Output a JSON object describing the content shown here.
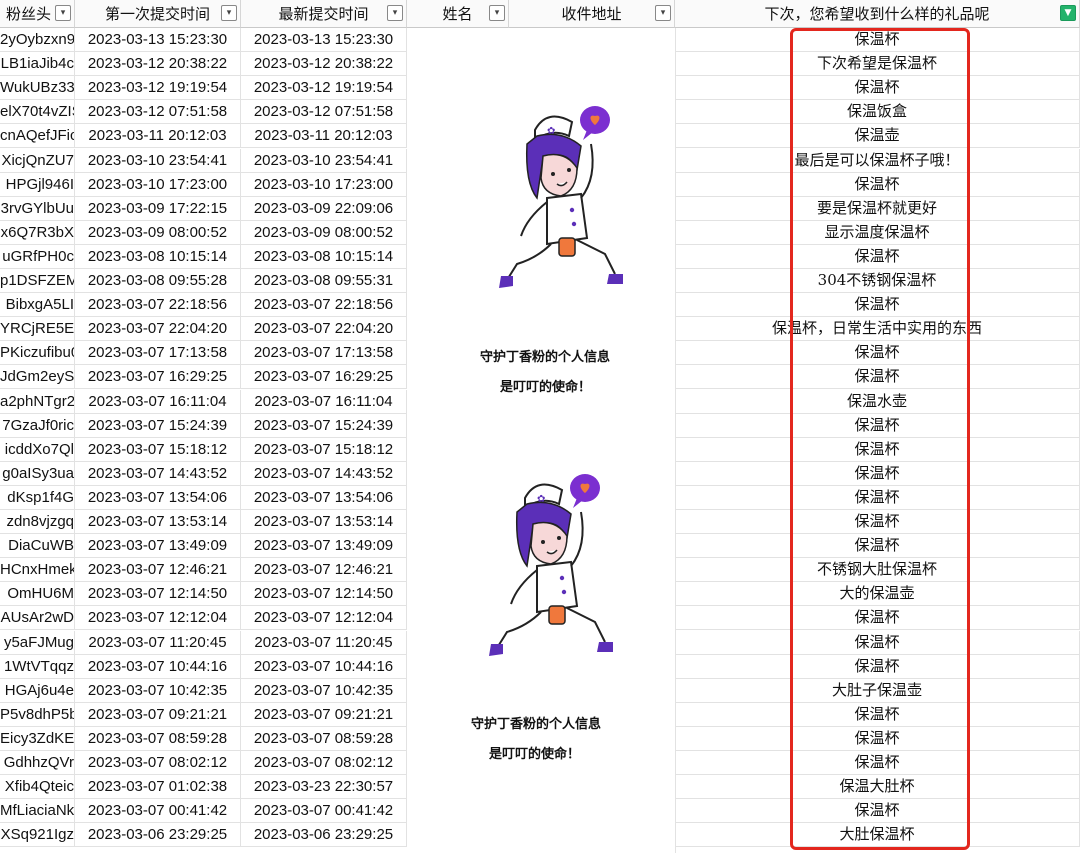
{
  "header": {
    "col_fan": "粉丝头",
    "col_first": "第一次提交时间",
    "col_latest": "最新提交时间",
    "col_name": "姓名",
    "col_address": "收件地址",
    "col_gift": "下次，您希望收到什么样的礼品呢"
  },
  "rows": [
    {
      "fan": "2yOybzxn9",
      "first": "2023-03-13 15:23:30",
      "latest": "2023-03-13 15:23:30",
      "gift": "保温杯"
    },
    {
      "fan": "LB1iaJib4c",
      "first": "2023-03-12 20:38:22",
      "latest": "2023-03-12 20:38:22",
      "gift": "下次希望是保温杯"
    },
    {
      "fan": "WukUBz33",
      "first": "2023-03-12 19:19:54",
      "latest": "2023-03-12 19:19:54",
      "gift": "保温杯"
    },
    {
      "fan": "elX70t4vZIS",
      "first": "2023-03-12 07:51:58",
      "latest": "2023-03-12 07:51:58",
      "gift": "保温饭盒"
    },
    {
      "fan": "cnAQefJFic",
      "first": "2023-03-11 20:12:03",
      "latest": "2023-03-11 20:12:03",
      "gift": "保温壶"
    },
    {
      "fan": "XicjQnZU7",
      "first": "2023-03-10 23:54:41",
      "latest": "2023-03-10 23:54:41",
      "gift": "最后是可以保温杯子哦！"
    },
    {
      "fan": "HPGjl946I",
      "first": "2023-03-10 17:23:00",
      "latest": "2023-03-10 17:23:00",
      "gift": "保温杯"
    },
    {
      "fan": "3rvGYlbUu",
      "first": "2023-03-09 17:22:15",
      "latest": "2023-03-09 22:09:06",
      "gift": "要是保温杯就更好"
    },
    {
      "fan": "x6Q7R3bX",
      "first": "2023-03-09 08:00:52",
      "latest": "2023-03-09 08:00:52",
      "gift": "显示温度保温杯"
    },
    {
      "fan": "uGRfPH0c",
      "first": "2023-03-08 10:15:14",
      "latest": "2023-03-08 10:15:14",
      "gift": "保温杯"
    },
    {
      "fan": "p1DSFZEM",
      "first": "2023-03-08 09:55:28",
      "latest": "2023-03-08 09:55:31",
      "gift": "304不锈钢保温杯"
    },
    {
      "fan": "BibxgA5LI",
      "first": "2023-03-07 22:18:56",
      "latest": "2023-03-07 22:18:56",
      "gift": "保温杯"
    },
    {
      "fan": "YRCjRE5E",
      "first": "2023-03-07 22:04:20",
      "latest": "2023-03-07 22:04:20",
      "gift": "保温杯，日常生活中实用的东西"
    },
    {
      "fan": "PKiczufibu0",
      "first": "2023-03-07 17:13:58",
      "latest": "2023-03-07 17:13:58",
      "gift": "保温杯"
    },
    {
      "fan": "JdGm2eyS",
      "first": "2023-03-07 16:29:25",
      "latest": "2023-03-07 16:29:25",
      "gift": "保温杯"
    },
    {
      "fan": "a2phNTgr2",
      "first": "2023-03-07 16:11:04",
      "latest": "2023-03-07 16:11:04",
      "gift": "保温水壶"
    },
    {
      "fan": "7GzaJf0ric",
      "first": "2023-03-07 15:24:39",
      "latest": "2023-03-07 15:24:39",
      "gift": "保温杯"
    },
    {
      "fan": "icddXo7Ql",
      "first": "2023-03-07 15:18:12",
      "latest": "2023-03-07 15:18:12",
      "gift": "保温杯"
    },
    {
      "fan": "g0aISy3ua",
      "first": "2023-03-07 14:43:52",
      "latest": "2023-03-07 14:43:52",
      "gift": "保温杯"
    },
    {
      "fan": "dKsp1f4G",
      "first": "2023-03-07 13:54:06",
      "latest": "2023-03-07 13:54:06",
      "gift": "保温杯"
    },
    {
      "fan": "zdn8vjzgq",
      "first": "2023-03-07 13:53:14",
      "latest": "2023-03-07 13:53:14",
      "gift": "保温杯"
    },
    {
      "fan": "DiaCuWB",
      "first": "2023-03-07 13:49:09",
      "latest": "2023-03-07 13:49:09",
      "gift": "保温杯"
    },
    {
      "fan": "HCnxHmek",
      "first": "2023-03-07 12:46:21",
      "latest": "2023-03-07 12:46:21",
      "gift": "不锈钢大肚保温杯"
    },
    {
      "fan": "OmHU6M",
      "first": "2023-03-07 12:14:50",
      "latest": "2023-03-07 12:14:50",
      "gift": "大的保温壶"
    },
    {
      "fan": "AUsAr2wD",
      "first": "2023-03-07 12:12:04",
      "latest": "2023-03-07 12:12:04",
      "gift": "保温杯"
    },
    {
      "fan": "y5aFJMug",
      "first": "2023-03-07 11:20:45",
      "latest": "2023-03-07 11:20:45",
      "gift": "保温杯"
    },
    {
      "fan": "1WtVTqqz",
      "first": "2023-03-07 10:44:16",
      "latest": "2023-03-07 10:44:16",
      "gift": "保温杯"
    },
    {
      "fan": "HGAj6u4e",
      "first": "2023-03-07 10:42:35",
      "latest": "2023-03-07 10:42:35",
      "gift": "大肚子保温壶"
    },
    {
      "fan": "P5v8dhP5b",
      "first": "2023-03-07 09:21:21",
      "latest": "2023-03-07 09:21:21",
      "gift": "保温杯"
    },
    {
      "fan": "Eicy3ZdKE",
      "first": "2023-03-07 08:59:28",
      "latest": "2023-03-07 08:59:28",
      "gift": "保温杯"
    },
    {
      "fan": "GdhhzQVr",
      "first": "2023-03-07 08:02:12",
      "latest": "2023-03-07 08:02:12",
      "gift": "保温杯"
    },
    {
      "fan": "Xfib4Qteic",
      "first": "2023-03-07 01:02:38",
      "latest": "2023-03-23 22:30:57",
      "gift": "保温大肚杯"
    },
    {
      "fan": "MfLiaciaNk",
      "first": "2023-03-07 00:41:42",
      "latest": "2023-03-07 00:41:42",
      "gift": "保温杯"
    },
    {
      "fan": "XSq921Igz",
      "first": "2023-03-06 23:29:25",
      "latest": "2023-03-06 23:29:25",
      "gift": "大肚保温杯"
    }
  ],
  "overlay": {
    "caption_line1": "守护丁香粉的个人信息",
    "caption_line2": "是叮叮的使命！"
  },
  "colors": {
    "highlight": "#e3271e",
    "filter_active": "#23b36b",
    "illustration_hair": "#5b2fb8",
    "speech_bubble": "#7b2fd0",
    "heart": "#f0783c"
  },
  "icons": {
    "dropdown": "dropdown-filter-icon",
    "active_filter": "filter-active-icon"
  }
}
